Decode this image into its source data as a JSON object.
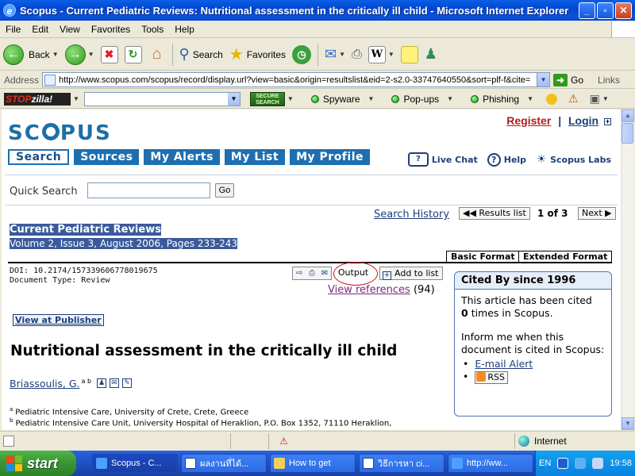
{
  "window": {
    "title": "Scopus - Current Pediatric Reviews: Nutritional assessment in the critically ill child - Microsoft Internet Explorer",
    "minimize": "_",
    "maximize": "▫",
    "close": "✕"
  },
  "menu": [
    "File",
    "Edit",
    "View",
    "Favorites",
    "Tools",
    "Help"
  ],
  "toolbar": {
    "back_label": "Back",
    "search_label": "Search",
    "favorites_label": "Favorites"
  },
  "addressbar": {
    "label": "Address",
    "url": "http://www.scopus.com/scopus/record/display.url?view=basic&origin=resultslist&eid=2-s2.0-33747640550&sort=plf-f&cite=",
    "go_label": "Go",
    "links_label": "Links"
  },
  "zillabar": {
    "logo_a": "STOP",
    "logo_b": "zilla!",
    "secure_search": "SECURE SEARCH",
    "items": [
      "Spyware",
      "Pop-ups",
      "Phishing"
    ]
  },
  "scopus": {
    "logo": "SC PUS",
    "register": "Register",
    "separator": "|",
    "login": "Login",
    "nav": [
      "Search",
      "Sources",
      "My Alerts",
      "My List",
      "My Profile"
    ],
    "live_chat": "Live Chat",
    "help": "Help",
    "labs": "Scopus Labs",
    "quick_search_label": "Quick Search",
    "quick_search_value": "",
    "go": "Go",
    "search_history": "Search History",
    "results_list": "Results list",
    "of_count": "1 of 3",
    "next": "Next"
  },
  "record": {
    "source_title": "Current Pediatric Reviews",
    "volume_info": "Volume 2, Issue 3, August 2006, Pages 233-243",
    "tab_basic": "Basic Format",
    "tab_extended": "Extended Format",
    "doi": "DOI: 10.2174/157339606778019675",
    "doc_type": "Document Type: Review",
    "output": "Output",
    "add_to_list": "Add to list",
    "view_references": "View references",
    "references_count": "(94)",
    "view_at_publisher": "View at Publisher",
    "title": "Nutritional assessment in the critically ill child",
    "author": "Briassoulis, G.",
    "author_affils": "a b",
    "affiliations": [
      {
        "marker": "a",
        "text": "Pediatric Intensive Care, University of Crete, Crete, Greece"
      },
      {
        "marker": "b",
        "text": "Pediatric Intensive Care Unit, University Hospital of Heraklion, P.O. Box 1352, 71110 Heraklion,"
      }
    ]
  },
  "cited_by": {
    "heading": "Cited By since 1996",
    "text_a": "This article has been cited",
    "count": "0",
    "text_b": "times in Scopus.",
    "inform": "Inform me when this document is cited in Scopus:",
    "email_alert": "E-mail Alert",
    "rss": "RSS"
  },
  "statusbar": {
    "zone": "Internet"
  },
  "taskbar": {
    "start": "start",
    "tasks": [
      "Scopus - C...",
      "ผลงานที่ได้...",
      "How to get",
      "วิธีการหา ci...",
      "http://ww..."
    ],
    "lang": "EN",
    "clock": "19:58"
  },
  "colors": {
    "scopus_blue": "#1e6fb0",
    "register_red": "#b01c1c",
    "highlight": "#3b5a9b",
    "output_circle": "#c8141e"
  }
}
